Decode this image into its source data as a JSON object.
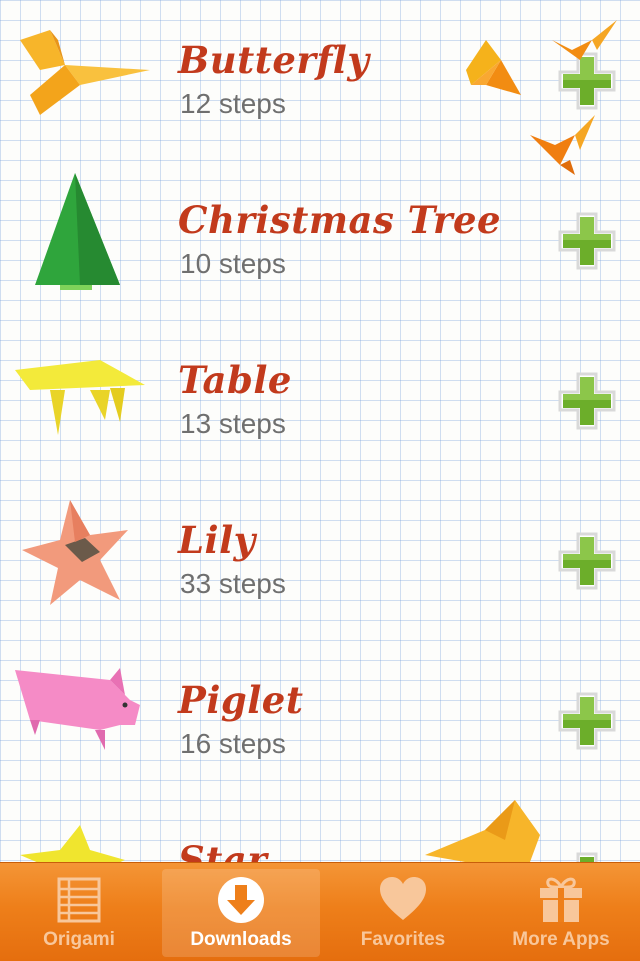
{
  "items": [
    {
      "title": "Butterfly",
      "steps": "12 steps",
      "icon": "butterfly-origami"
    },
    {
      "title": "Christmas Tree",
      "steps": "10 steps",
      "icon": "christmas-tree-origami"
    },
    {
      "title": "Table",
      "steps": "13 steps",
      "icon": "table-origami"
    },
    {
      "title": "Lily",
      "steps": "33 steps",
      "icon": "lily-origami"
    },
    {
      "title": "Piglet",
      "steps": "16 steps",
      "icon": "piglet-origami"
    },
    {
      "title": "Star",
      "steps": "",
      "icon": "star-origami"
    }
  ],
  "tabs": [
    {
      "label": "Origami",
      "icon": "list-icon",
      "active": false
    },
    {
      "label": "Downloads",
      "icon": "download-icon",
      "active": true
    },
    {
      "label": "Favorites",
      "icon": "heart-icon",
      "active": false
    },
    {
      "label": "More Apps",
      "icon": "gift-icon",
      "active": false
    }
  ],
  "colors": {
    "title": "#c23a1c",
    "steps": "#6f6f6f",
    "add_button": "#6cae2a",
    "tabbar": "#ee7f1a"
  }
}
